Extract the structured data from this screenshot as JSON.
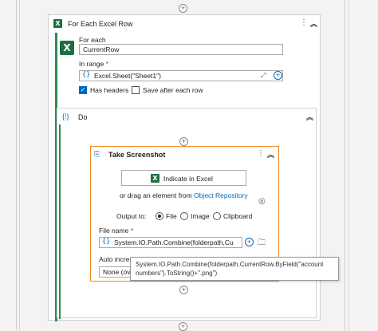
{
  "for_each": {
    "title": "For Each Excel Row",
    "for_each_label": "For each",
    "for_each_value": "CurrentRow",
    "in_range_label": "In range",
    "required_mark": "*",
    "in_range_value": "Excel.Sheet(\"Sheet1\")",
    "has_headers_label": "Has headers",
    "has_headers_checked": true,
    "save_after_label": "Save after each row",
    "save_after_checked": false
  },
  "do_block": {
    "title": "Do"
  },
  "screenshot": {
    "title": "Take Screenshot",
    "indicate_button": "Indicate in Excel",
    "drag_text": "or drag an element from",
    "repo_link": "Object Repository",
    "output_label": "Output to:",
    "output_options": [
      "File",
      "Image",
      "Clipboard"
    ],
    "output_selected": "File",
    "file_name_label": "File name",
    "file_name_value": "System.IO.Path.Combine(folderpath,Cu",
    "auto_increment_label": "Auto incre",
    "auto_increment_value": "None (ov"
  },
  "tooltip": {
    "line1": "System.IO.Path.Combine(folderpath,CurrentRow.ByField(\"account",
    "line2": "numbers\").ToString()+\".png\")"
  },
  "colors": {
    "accent": "#0067c0",
    "excel_green": "#1d6f42",
    "selected_border": "#f08a24"
  }
}
